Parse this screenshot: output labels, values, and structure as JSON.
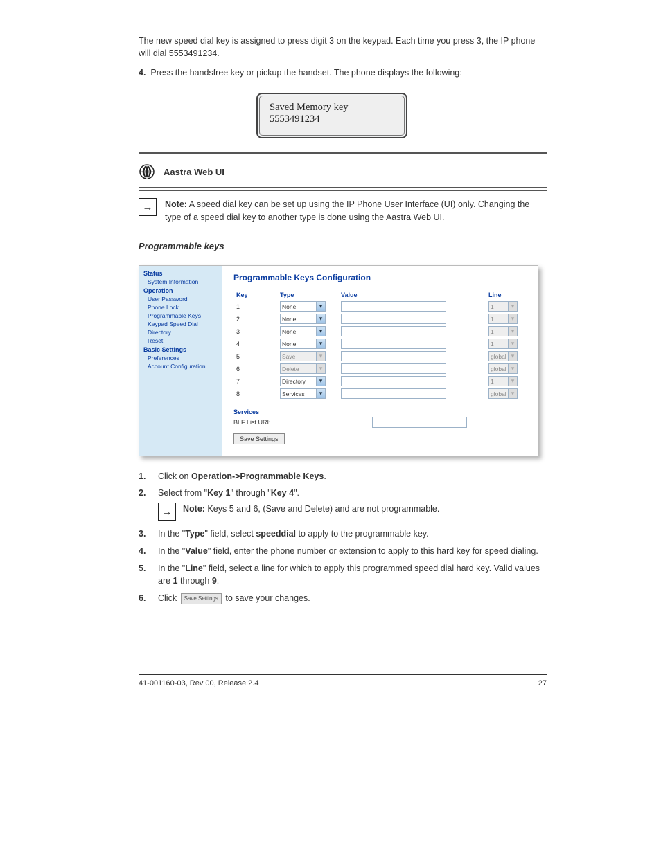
{
  "foreword": "The new speed dial key is assigned to press digit 3 on the keypad. Each time you press 3, the IP phone will dial 5553491234.",
  "instruction_4": "Press the handsfree key or pickup the handset. The phone displays the following:",
  "lcd": {
    "line1": "Saved Memory key",
    "line2": "5553491234"
  },
  "web_icon_label": "Aastra Web UI",
  "note_text": "A speed dial key can be set up using the IP Phone User Interface (UI) only. Changing the type of a speed dial key to another type is done using the Aastra Web UI.",
  "webui": {
    "title": "Programmable Keys Configuration",
    "side": {
      "status": "Status",
      "sys_info": "System Information",
      "operation": "Operation",
      "items1": [
        "User Password",
        "Phone Lock",
        "Programmable Keys",
        "Keypad Speed Dial",
        "Directory",
        "Reset"
      ],
      "basic": "Basic Settings",
      "items2": [
        "Preferences",
        "Account Configuration"
      ]
    },
    "cols": {
      "key": "Key",
      "type": "Type",
      "value": "Value",
      "line": "Line"
    },
    "rows": [
      {
        "k": "1",
        "type": "None",
        "ro": false,
        "line": "1",
        "lro": true
      },
      {
        "k": "2",
        "type": "None",
        "ro": false,
        "line": "1",
        "lro": true
      },
      {
        "k": "3",
        "type": "None",
        "ro": false,
        "line": "1",
        "lro": true
      },
      {
        "k": "4",
        "type": "None",
        "ro": false,
        "line": "1",
        "lro": true
      },
      {
        "k": "5",
        "type": "Save",
        "ro": true,
        "line": "global",
        "lro": true
      },
      {
        "k": "6",
        "type": "Delete",
        "ro": true,
        "line": "global",
        "lro": true
      },
      {
        "k": "7",
        "type": "Directory",
        "ro": false,
        "line": "1",
        "lro": true
      },
      {
        "k": "8",
        "type": "Services",
        "ro": false,
        "line": "global",
        "lro": true
      }
    ],
    "services_h": "Services",
    "blf_label": "BLF List URI:",
    "save_btn": "Save Settings"
  },
  "steps": [
    "Click on Operation->Programmable Keys.",
    "Select from \"Key 1\" through \"Key 4\".",
    "In the \"Type\" field, select speeddial to apply to the programmable key.",
    "In the \"Value\" field, enter the phone number or extension to apply to this hard key for speed dialing.",
    "In the \"Line\" field, select a line for which to apply this programmed speed dial hard key. Valid values are 1 through 9.",
    "Click                       to save your changes."
  ],
  "inline_note_label": "Note:",
  "inline_note_text": " Keys 5 and 6, (Save and Delete) and are not programmable.",
  "save_settings_label": "Save Settings",
  "footer": {
    "left": "41-001160-03, Rev 00, Release 2.4",
    "right": "27"
  },
  "section_heading": "Programmable keys"
}
